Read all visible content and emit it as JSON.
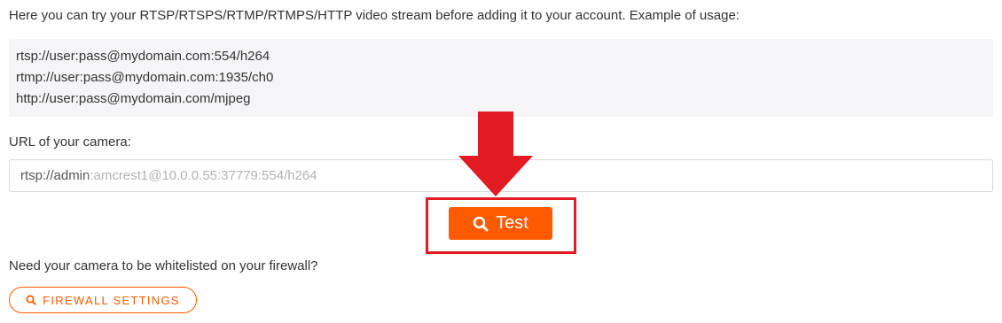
{
  "intro_text": "Here you can try your RTSP/RTSPS/RTMP/RTMPS/HTTP video stream before adding it to your account. Example of usage:",
  "examples": [
    "rtsp://user:pass@mydomain.com:554/h264",
    "rtmp://user:pass@mydomain.com:1935/ch0",
    "http://user:pass@mydomain.com/mjpeg"
  ],
  "url_field": {
    "label": "URL of your camera:",
    "value": "rtsp://admin:amcrest1@10.0.0.55:37779:554/h264"
  },
  "test_button": {
    "label": "Test",
    "icon": "search-icon",
    "color": "#ff5a00"
  },
  "annotation": {
    "arrow_color": "#e21b23",
    "box_color": "#e21b23"
  },
  "firewall": {
    "question": "Need your camera to be whitelisted on your firewall?",
    "button_label": "FIREWALL SETTINGS",
    "button_icon": "search-icon"
  }
}
